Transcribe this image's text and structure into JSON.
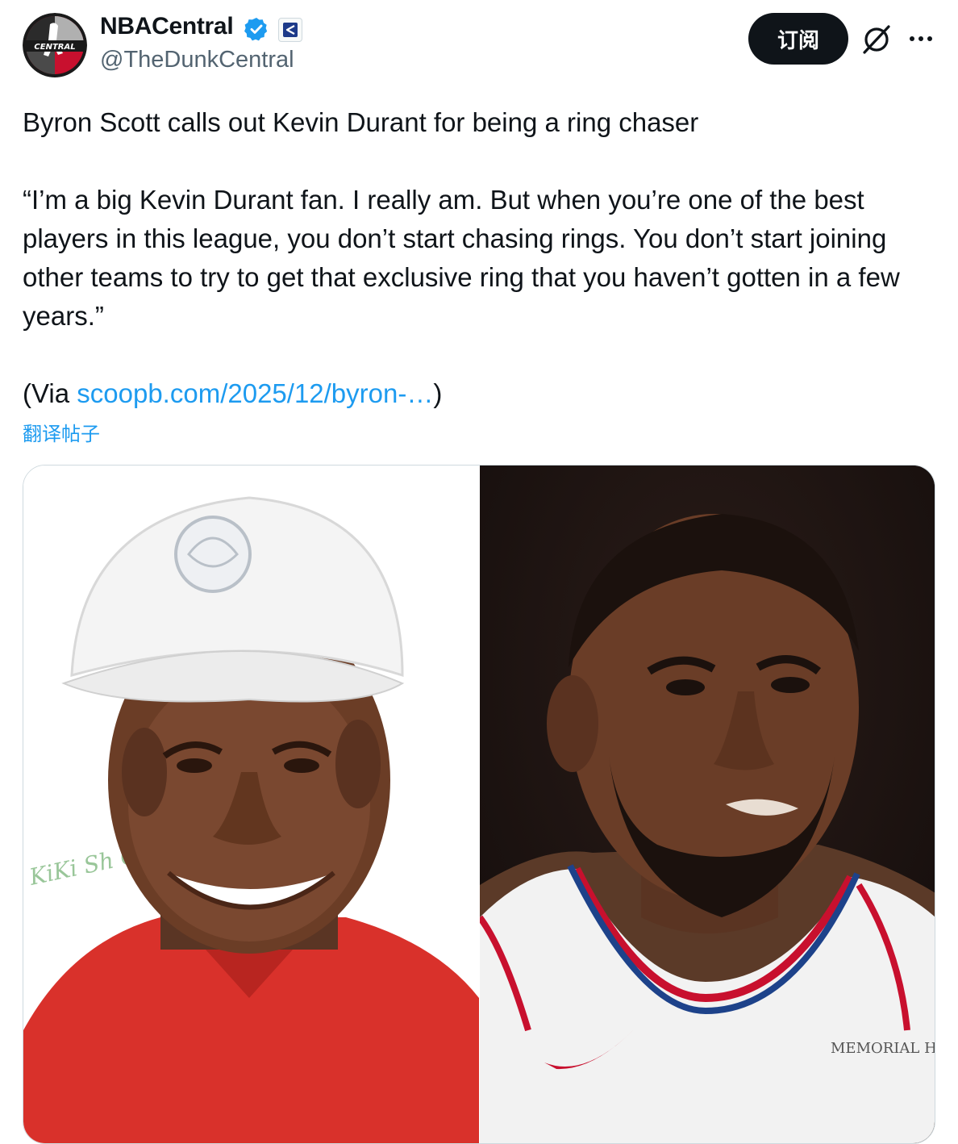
{
  "author": {
    "display_name": "NBACentral",
    "handle": "@TheDunkCentral",
    "avatar_text": "CENTRAL"
  },
  "header": {
    "subscribe_label": "订阅",
    "grok_icon": "grok-icon",
    "more_icon": "more-icon"
  },
  "tweet": {
    "headline": "Byron Scott calls out Kevin Durant for being a ring chaser",
    "quote": "“I’m a big Kevin Durant fan. I really am. But when you’re one of the best players in this league, you don’t start chasing rings. You don’t start joining other teams to try to get that exclusive ring that you haven’t gotten in a few years.”",
    "via_prefix": "(Via ",
    "via_link": "scoopb.com/2025/12/byron-…",
    "via_suffix": ")",
    "translate_label": "翻译帖子"
  },
  "media": {
    "left_background_text": "KiKi Sh Cel Golf",
    "right_jersey_patch": "MEMORIAL HERMANN"
  },
  "colors": {
    "accent": "#1d9bf0",
    "text": "#0f1419",
    "muted": "#536471",
    "button": "#0f1419"
  }
}
